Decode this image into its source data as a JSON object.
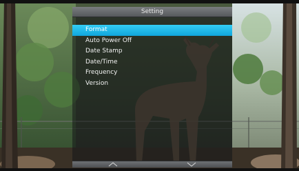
{
  "menu": {
    "title": "Setting",
    "items": [
      {
        "label": "Format",
        "selected": true
      },
      {
        "label": "Auto Power Off",
        "selected": false
      },
      {
        "label": "Date Stamp",
        "selected": false
      },
      {
        "label": "Date/Time",
        "selected": false
      },
      {
        "label": "Frequency",
        "selected": false
      },
      {
        "label": "Version",
        "selected": false
      }
    ],
    "footer": {
      "up_icon": "chevron-up-icon",
      "down_icon": "chevron-down-icon"
    }
  },
  "colors": {
    "selection": "#1ab6e8",
    "header": "#6b6e71",
    "text": "#f2f2f2"
  }
}
